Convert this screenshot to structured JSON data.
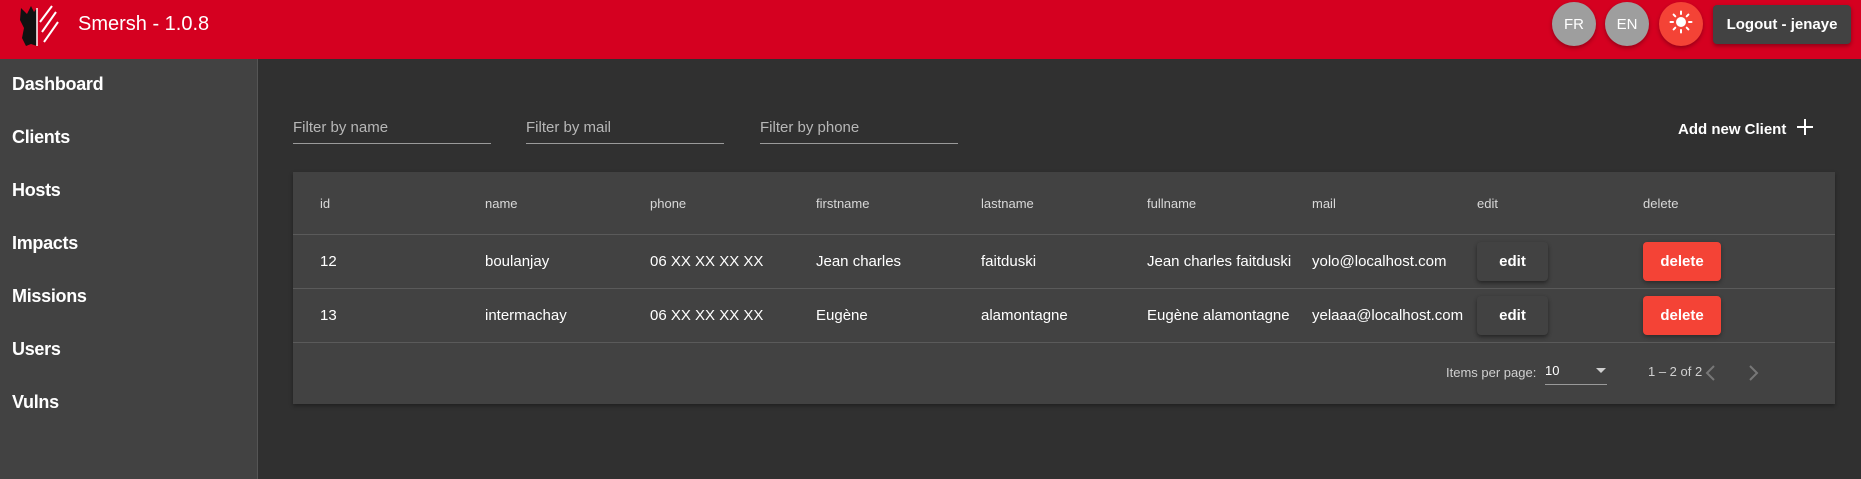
{
  "header": {
    "title": "Smersh - 1.0.8",
    "lang_fr": "FR",
    "lang_en": "EN",
    "theme_icon": "sun-icon",
    "logout_label": "Logout - jenaye",
    "brand_color": "#d50020"
  },
  "sidebar": {
    "items": [
      {
        "label": "Dashboard"
      },
      {
        "label": "Clients"
      },
      {
        "label": "Hosts"
      },
      {
        "label": "Impacts"
      },
      {
        "label": "Missions"
      },
      {
        "label": "Users"
      },
      {
        "label": "Vulns"
      }
    ]
  },
  "filters": {
    "name_placeholder": "Filter by name",
    "mail_placeholder": "Filter by mail",
    "phone_placeholder": "Filter by phone"
  },
  "add_button": {
    "label": "Add new Client",
    "icon": "plus-icon"
  },
  "table": {
    "columns": [
      "id",
      "name",
      "phone",
      "firstname",
      "lastname",
      "fullname",
      "mail",
      "edit",
      "delete"
    ],
    "rows": [
      {
        "id": "12",
        "name": "boulanjay",
        "phone": "06 XX XX XX XX",
        "firstname": "Jean charles",
        "lastname": "faitduski",
        "fullname": "Jean charles faitduski",
        "mail": "yolo@localhost.com",
        "edit": "edit",
        "delete": "delete"
      },
      {
        "id": "13",
        "name": "intermachay",
        "phone": "06 XX XX XX XX",
        "firstname": "Eugène",
        "lastname": "alamontagne",
        "fullname": "Eugène alamontagne",
        "mail": "yelaaa@localhost.com",
        "edit": "edit",
        "delete": "delete"
      }
    ],
    "delete_color": "#f44336"
  },
  "paginator": {
    "items_per_page_label": "Items per page:",
    "items_per_page_value": "10",
    "range_label": "1 – 2 of 2",
    "prev_icon": "chevron-left-icon",
    "next_icon": "chevron-right-icon"
  }
}
